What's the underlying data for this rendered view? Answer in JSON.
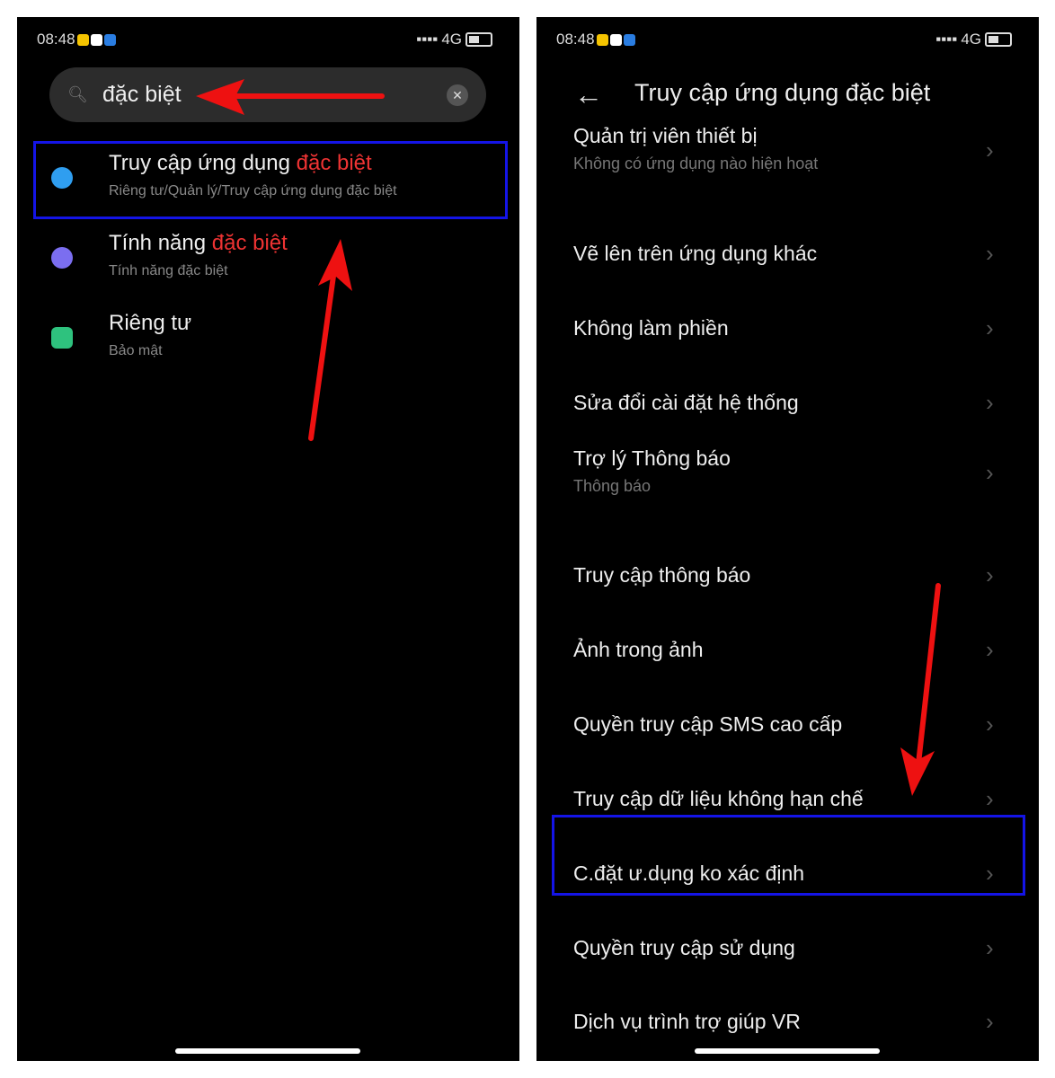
{
  "status": {
    "time": "08:48",
    "network": "4G"
  },
  "left": {
    "search": {
      "value": "đặc biệt"
    },
    "results": [
      {
        "title": "Truy cập ứng dụng ",
        "highlight": "đặc biệt",
        "subtitle": "Riêng tư/Quản lý/Truy cập ứng dụng đặc biệt",
        "icon": "special-access-icon",
        "color": "#2f9ef0"
      },
      {
        "title": "Tính năng ",
        "highlight": "đặc biệt",
        "subtitle": "Tính năng đặc biệt",
        "icon": "flask-icon",
        "color": "#7b6ef0"
      },
      {
        "title": "Riêng tư",
        "highlight": "",
        "subtitle": "Bảo mật",
        "icon": "shield-icon",
        "color": "#2ec27e"
      }
    ]
  },
  "right": {
    "title": "Truy cập ứng dụng đặc biệt",
    "items": [
      {
        "label": "Quản trị viên thiết bị",
        "sub": "Không có ứng dụng nào hiện hoạt"
      },
      {
        "label": "Vẽ lên trên ứng dụng khác"
      },
      {
        "label": "Không làm phiền"
      },
      {
        "label": "Sửa đổi cài đặt hệ thống"
      },
      {
        "label": "Trợ lý Thông báo",
        "sub": "Thông báo"
      },
      {
        "label": "Truy cập thông báo"
      },
      {
        "label": "Ảnh trong ảnh"
      },
      {
        "label": "Quyền truy cập SMS cao cấp"
      },
      {
        "label": "Truy cập dữ liệu không hạn chế"
      },
      {
        "label": "C.đặt ư.dụng ko xác định"
      },
      {
        "label": "Quyền truy cập sử dụng"
      },
      {
        "label": "Dịch vụ trình trợ giúp VR"
      }
    ]
  },
  "colors": {
    "annotation_arrow": "#ee1111",
    "highlight_box": "#1414e6",
    "match_text": "#e33333"
  }
}
